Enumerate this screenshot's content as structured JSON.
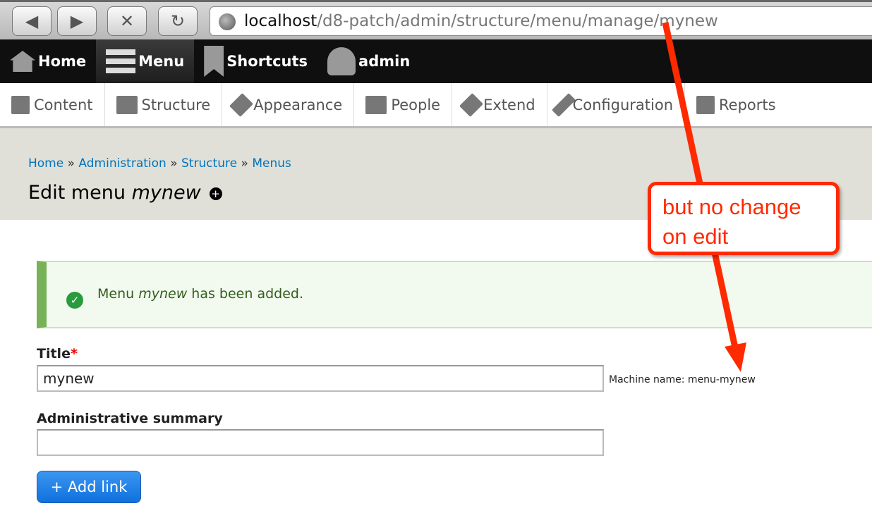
{
  "browser": {
    "url_host": "localhost",
    "url_path": "/d8-patch/admin/structure/menu/manage/mynew",
    "back": "◀",
    "forward": "▶",
    "stop": "✕",
    "reload": "↻"
  },
  "toolbar": [
    {
      "label": "Home"
    },
    {
      "label": "Menu"
    },
    {
      "label": "Shortcuts"
    },
    {
      "label": "admin"
    }
  ],
  "tray": [
    {
      "label": "Content"
    },
    {
      "label": "Structure"
    },
    {
      "label": "Appearance"
    },
    {
      "label": "People"
    },
    {
      "label": "Extend"
    },
    {
      "label": "Configuration"
    },
    {
      "label": "Reports"
    }
  ],
  "breadcrumb": [
    "Home",
    "Administration",
    "Structure",
    "Menus"
  ],
  "breadcrumb_sep": "»",
  "page_title": {
    "prefix": "Edit menu",
    "name": "mynew",
    "plus": "+"
  },
  "message": {
    "before": "Menu",
    "name": "mynew",
    "after": "has been added.",
    "icon": "✓"
  },
  "form": {
    "title_label": "Title",
    "required": "*",
    "title_value": "mynew",
    "machine_name": "Machine name: menu-mynew",
    "summary_label": "Administrative summary",
    "summary_value": "",
    "add_link": "+ Add link"
  },
  "annotation": {
    "text_line1": "but no change",
    "text_line2": "on edit",
    "color": "#ff2a00"
  }
}
